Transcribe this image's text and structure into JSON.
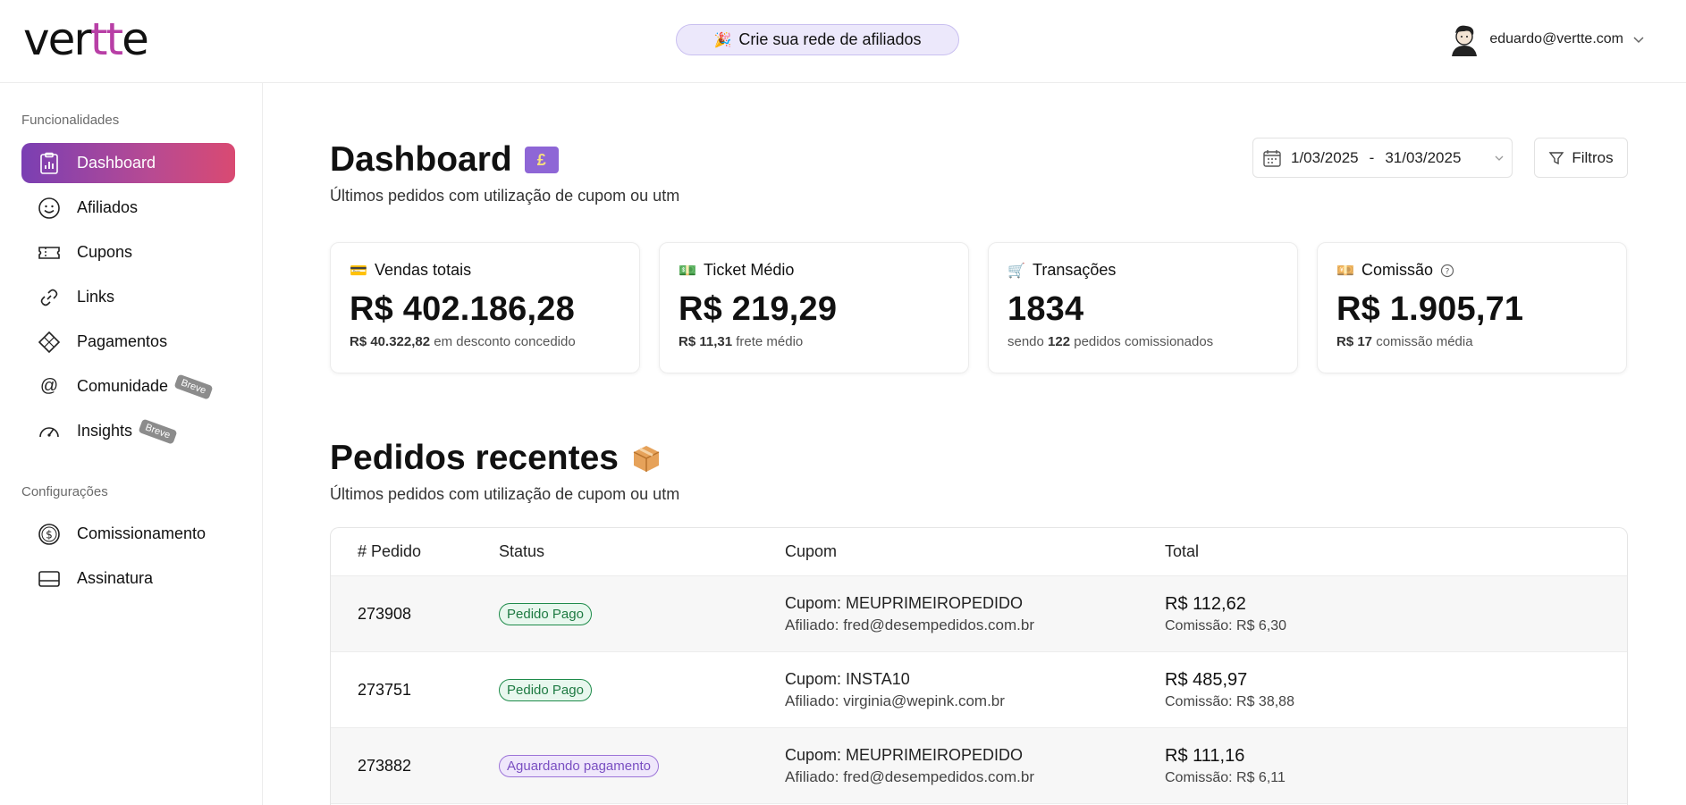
{
  "header": {
    "logo_prefix": "ver",
    "logo_tt": "tt",
    "logo_suffix": "e",
    "promo_label": "Crie sua rede de afiliados",
    "user_email": "eduardo@vertte.com"
  },
  "sidebar": {
    "section1_label": "Funcionalidades",
    "section2_label": "Configurações",
    "items": [
      {
        "label": "Dashboard",
        "icon": "clipboard-chart-icon",
        "active": true
      },
      {
        "label": "Afiliados",
        "icon": "smiley-icon"
      },
      {
        "label": "Cupons",
        "icon": "ticket-icon"
      },
      {
        "label": "Links",
        "icon": "link-icon"
      },
      {
        "label": "Pagamentos",
        "icon": "diamond-icon"
      },
      {
        "label": "Comunidade",
        "icon": "at-icon",
        "badge": "Breve"
      },
      {
        "label": "Insights",
        "icon": "gauge-icon",
        "badge": "Breve"
      }
    ],
    "config_items": [
      {
        "label": "Comissionamento",
        "icon": "dollar-circle-icon"
      },
      {
        "label": "Assinatura",
        "icon": "card-icon"
      }
    ]
  },
  "main": {
    "title": "Dashboard",
    "subtitle": "Últimos pedidos com utilização de cupom ou utm",
    "date_start": "1/03/2025",
    "date_sep": "-",
    "date_end": "31/03/2025",
    "filters_label": "Filtros",
    "cards": [
      {
        "title": "Vendas totais",
        "value": "R$ 402.186,28",
        "note_bold": "R$ 40.322,82",
        "note_text": " em desconto concedido",
        "note_prefix": ""
      },
      {
        "title": "Ticket Médio",
        "value": "R$ 219,29",
        "note_bold": "R$ 11,31",
        "note_text": " frete médio",
        "note_prefix": ""
      },
      {
        "title": "Transações",
        "value": "1834",
        "note_prefix": "sendo ",
        "note_bold": "122",
        "note_text": " pedidos comissionados"
      },
      {
        "title": "Comissão",
        "value": "R$ 1.905,71",
        "note_bold": "R$ 17",
        "note_text": " comissão média",
        "note_prefix": ""
      }
    ],
    "recent_title": "Pedidos recentes",
    "recent_subtitle": "Últimos pedidos com utilização de cupom ou utm",
    "table": {
      "headers": [
        "# Pedido",
        "Status",
        "Cupom",
        "Total"
      ],
      "rows": [
        {
          "order": "273908",
          "status": "Pedido Pago",
          "status_type": "paid",
          "coupon": "Cupom: MEUPRIMEIROPEDIDO",
          "affiliate": "Afiliado: fred@desempedidos.com.br",
          "total": "R$ 112,62",
          "commission": "Comissão: R$ 6,30"
        },
        {
          "order": "273751",
          "status": "Pedido Pago",
          "status_type": "paid",
          "coupon": "Cupom: INSTA10",
          "affiliate": "Afiliado: virginia@wepink.com.br",
          "total": "R$ 485,97",
          "commission": "Comissão: R$ 38,88"
        },
        {
          "order": "273882",
          "status": "Aguardando pagamento",
          "status_type": "wait",
          "coupon": "Cupom: MEUPRIMEIROPEDIDO",
          "affiliate": "Afiliado: fred@desempedidos.com.br",
          "total": "R$ 111,16",
          "commission": "Comissão: R$ 6,11"
        }
      ]
    }
  },
  "colors": {
    "accent_start": "#7a3fb3",
    "accent_end": "#d94a72",
    "paid_green": "#1e7a42",
    "wait_purple": "#7a4fc2"
  }
}
